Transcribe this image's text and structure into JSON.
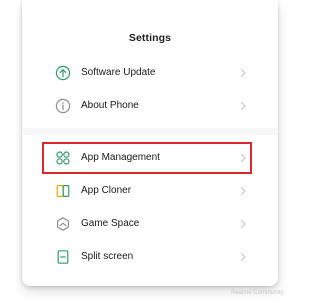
{
  "header": {
    "title": "Settings"
  },
  "settings": {
    "items": [
      {
        "label": "Software Update",
        "icon": "update-arrow-icon"
      },
      {
        "label": "About Phone",
        "icon": "info-icon"
      },
      {
        "label": "App Management",
        "icon": "app-grid-icon",
        "highlighted": true
      },
      {
        "label": "App Cloner",
        "icon": "app-cloner-icon"
      },
      {
        "label": "Game Space",
        "icon": "game-space-icon"
      },
      {
        "label": "Split screen",
        "icon": "split-screen-icon"
      }
    ]
  },
  "colors": {
    "icon_green": "#2fa06a",
    "icon_gray": "#8e8e93",
    "icon_orange": "#f0a30a",
    "highlight_border": "#d9272d",
    "chevron": "#c4c4c4"
  },
  "watermark": {
    "text": "Realme Community"
  }
}
